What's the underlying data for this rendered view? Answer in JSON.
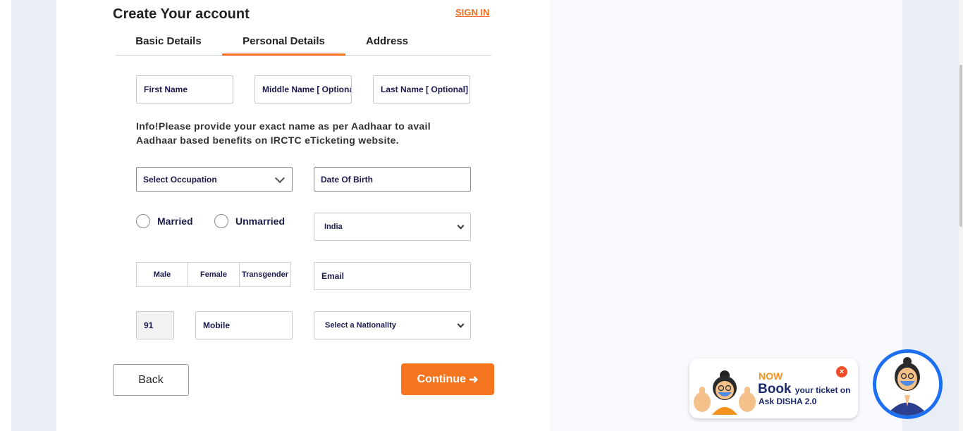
{
  "header": {
    "title": "Create Your account",
    "signin_label": "SIGN IN"
  },
  "tabs": [
    {
      "label": "Basic Details",
      "active": false
    },
    {
      "label": "Personal Details",
      "active": true
    },
    {
      "label": "Address",
      "active": false
    }
  ],
  "form": {
    "first_name_placeholder": "First Name",
    "middle_name_placeholder": "Middle Name  [ Optional]",
    "last_name_placeholder": "Last Name  [ Optional]",
    "info_text": "Info!Please provide your exact name as per Aadhaar to avail Aadhaar based benefits on IRCTC eTicketing website.",
    "occupation_selected": "Select Occupation",
    "dob_placeholder": "Date Of Birth",
    "marital": {
      "married": "Married",
      "unmarried": "Unmarried"
    },
    "country_selected": "India",
    "gender": {
      "male": "Male",
      "female": "Female",
      "transgender": "Transgender"
    },
    "email_placeholder": "Email",
    "isd_code": "91",
    "mobile_placeholder": "Mobile",
    "nationality_selected": "Select a Nationality"
  },
  "buttons": {
    "back": "Back",
    "continue": "Continue",
    "continue_icon": "arrow-right-icon"
  },
  "disha": {
    "now": "NOW",
    "book": "Book",
    "your_ticket_on": "your ticket on",
    "ask_disha": "Ask DISHA 2.0",
    "close": "×"
  },
  "colors": {
    "accent": "#f26f21",
    "button": "#f6761f",
    "navy": "#1b1b4d",
    "disha_blue": "#1d6ff2"
  }
}
